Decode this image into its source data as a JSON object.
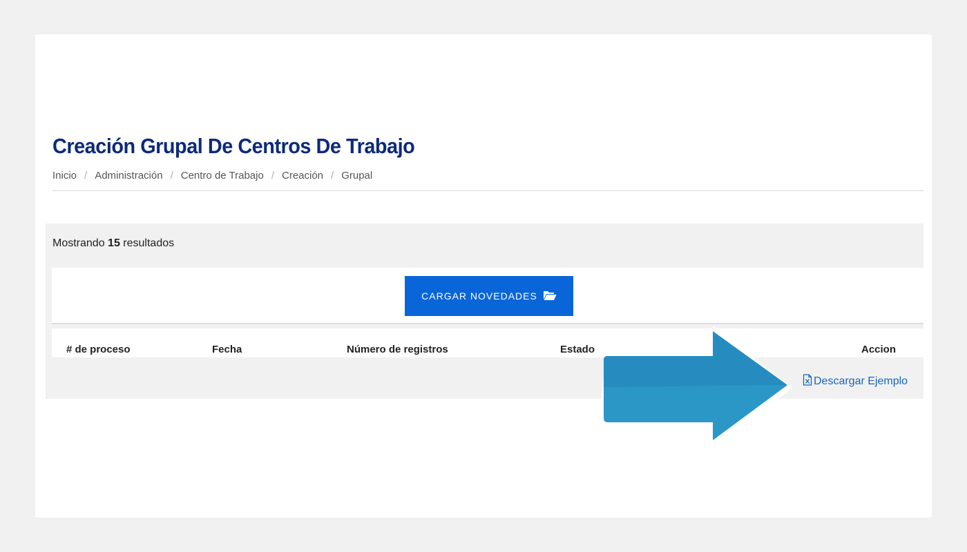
{
  "header": {
    "title": "Creación Grupal De Centros De Trabajo"
  },
  "breadcrumb": {
    "items": [
      "Inicio",
      "Administración",
      "Centro de Trabajo",
      "Creación",
      "Grupal"
    ],
    "separator": "/"
  },
  "results": {
    "prefix": "Mostrando",
    "count": "15",
    "suffix": "resultados"
  },
  "upload": {
    "button_label": "CARGAR NOVEDADES",
    "icon": "folder-open-icon"
  },
  "table": {
    "columns": [
      "# de proceso",
      "Fecha",
      "Número de registros",
      "Estado",
      "Accion"
    ]
  },
  "actions": {
    "download_label": "Descargar Ejemplo",
    "download_icon": "excel-file-icon"
  },
  "overlay": {
    "arrow_color": "#2a97c6"
  },
  "colors": {
    "title": "#0d2a7a",
    "primary_button": "#0a66d8",
    "link": "#1565c0",
    "panel_bg": "#f1f1f1"
  }
}
